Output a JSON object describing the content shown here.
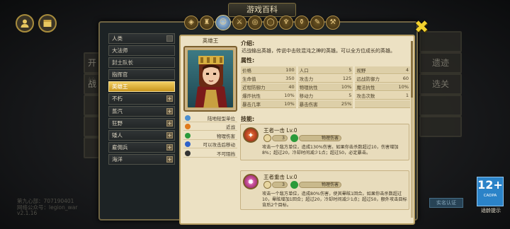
{
  "panel": {
    "title": "游戏百科"
  },
  "background": {
    "left_buttons": [
      "开始",
      "战",
      "",
      "",
      ""
    ],
    "right_buttons": [
      "",
      "遗迹",
      "选关",
      "",
      ""
    ]
  },
  "tab_icons": [
    "shield",
    "helmet",
    "hero",
    "sword",
    "spiral",
    "ring",
    "totem",
    "potion",
    "book",
    "tools"
  ],
  "categories": [
    {
      "label": "人类",
      "expand": "dash"
    },
    {
      "label": "大法师",
      "expand": ""
    },
    {
      "label": "封土队长",
      "expand": ""
    },
    {
      "label": "指挥官",
      "expand": ""
    },
    {
      "label": "英雄王",
      "expand": "",
      "active": true
    },
    {
      "label": "不朽",
      "expand": "plus"
    },
    {
      "label": "蒸汽",
      "expand": "plus"
    },
    {
      "label": "狂野",
      "expand": "plus"
    },
    {
      "label": "矮人",
      "expand": "plus"
    },
    {
      "label": "雇佣兵",
      "expand": "plus"
    },
    {
      "label": "海洋",
      "expand": "plus"
    }
  ],
  "hero": {
    "name": "英雄王",
    "traits": [
      {
        "label": "陆地轻型单位",
        "icon": "land-icon",
        "color": "#4c8fcf"
      },
      {
        "label": "近战",
        "icon": "melee-icon",
        "color": "#e07a1c"
      },
      {
        "label": "物理伤害",
        "icon": "physical-damage-icon",
        "color": "#2b9a3a"
      },
      {
        "label": "可以攻击后移动",
        "icon": "move-icon",
        "color": "#2f62c9"
      },
      {
        "label": "不可阻挡",
        "icon": "unstoppable-icon",
        "color": "#333333"
      }
    ]
  },
  "intro": {
    "label": "介绍:",
    "text": "近战输出英雄，传说中击败混沌之神的英雄。可以全方位成长的英雄。"
  },
  "stats": {
    "label": "属性:",
    "rows": [
      [
        {
          "name": "价格",
          "value": "100"
        },
        {
          "name": "人口",
          "value": "5"
        },
        {
          "name": "视野",
          "value": "4"
        }
      ],
      [
        {
          "name": "生命值",
          "value": "350"
        },
        {
          "name": "攻击力",
          "value": "125"
        },
        {
          "name": "远战防御力",
          "value": "60"
        }
      ],
      [
        {
          "name": "近程防御力",
          "value": "40"
        },
        {
          "name": "物理抗性",
          "value": "10%"
        },
        {
          "name": "魔法抗性",
          "value": "10%"
        }
      ],
      [
        {
          "name": "爆炸抗性",
          "value": "10%"
        },
        {
          "name": "移动力",
          "value": "5"
        },
        {
          "name": "攻击次数",
          "value": "1"
        }
      ],
      [
        {
          "name": "暴击几率",
          "value": "10%"
        },
        {
          "name": "暴击伤害",
          "value": "25%"
        },
        {
          "name": "",
          "value": ""
        }
      ]
    ]
  },
  "skills": {
    "label": "技能:",
    "items": [
      {
        "name": "王者一击 Lv.0",
        "cooldown": "3",
        "type": "物理伤害",
        "icon": "fire-strike-icon",
        "icon_color": "#c23a1e",
        "desc": "攻击一个敌方单位，造成130%伤害。如果你击杀数超过10，伤害增加8%；超过20，冷却时间减少1点；超过50，必定暴击。"
      },
      {
        "name": "王者重击 Lv.0",
        "cooldown": "3",
        "type": "物理伤害",
        "icon": "heavy-strike-icon",
        "icon_color": "#c2368a",
        "desc": "攻击一个敌方单位，造成80%伤害，使其晕眩1回合。如果你击杀数超过10，晕眩增加1回合；超过20，冷却时间减少1点；超过50，额外攻击目标背后2个目标。"
      }
    ]
  },
  "footer": {
    "line1": "第九心部：707190401",
    "line2": "网络公众号：legion_war",
    "line3": "v2.1.16"
  },
  "rating": {
    "age": "12+",
    "org": "CADPA",
    "tip": "适龄提示"
  },
  "right_button": "实名认证"
}
